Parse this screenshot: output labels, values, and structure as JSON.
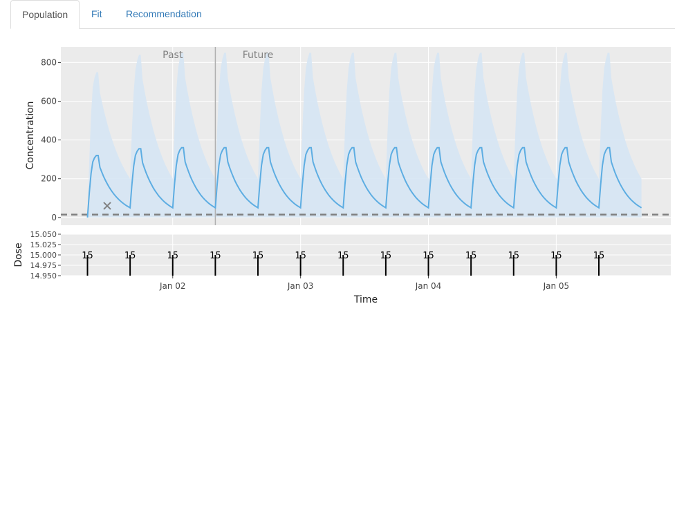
{
  "tabs": [
    {
      "label": "Population",
      "active": true
    },
    {
      "label": "Fit",
      "active": false
    },
    {
      "label": "Recommendation",
      "active": false
    }
  ],
  "colors": {
    "background": "#ebebeb",
    "prediction_line": "#5dade2",
    "interval_band": "#d6e6f4",
    "threshold": "#7f7f7f",
    "observation": "#7f7f7f",
    "dose_bar": "#000000"
  },
  "chart_data": [
    {
      "type": "area",
      "ylabel": "Concentration",
      "xlabel": "",
      "ylim": [
        -40,
        880
      ],
      "y_ticks": [
        0,
        200,
        400,
        600,
        800
      ],
      "x_range_hours": [
        0,
        114.5
      ],
      "x_ticks": [
        {
          "hour": 21,
          "label": "Jan 02"
        },
        {
          "hour": 45,
          "label": "Jan 03"
        },
        {
          "hour": 69,
          "label": "Jan 04"
        },
        {
          "hour": 93,
          "label": "Jan 05"
        }
      ],
      "now_hour": 29,
      "regions": [
        {
          "label": "Past",
          "hour": 21
        },
        {
          "label": "Future",
          "hour": 37
        }
      ],
      "threshold": 15,
      "dose_interval_hours": 8,
      "dose_start_hour": 5,
      "num_doses": 13,
      "prediction_end_hour": 109,
      "median_peak": [
        320,
        355,
        360,
        360,
        360,
        360,
        360,
        360,
        360,
        360,
        360,
        360,
        360
      ],
      "median_trough": [
        50,
        50,
        50,
        50,
        50,
        50,
        50,
        50,
        50,
        50,
        50,
        50,
        50
      ],
      "upper_peak": [
        750,
        840,
        850,
        850,
        850,
        850,
        850,
        850,
        850,
        850,
        850,
        850,
        850
      ],
      "upper_trough": [
        200,
        200,
        200,
        200,
        200,
        200,
        200,
        200,
        200,
        200,
        200,
        200,
        200
      ],
      "observations": [
        {
          "hour": 8.7,
          "value": 60
        }
      ]
    },
    {
      "type": "bar",
      "ylabel": "Dose",
      "xlabel": "Time",
      "ylim": [
        14.95,
        15.05
      ],
      "y_ticks": [
        14.95,
        14.975,
        15.0,
        15.025,
        15.05
      ],
      "y_tick_labels": [
        "14.950",
        "14.975",
        "15.000",
        "15.025",
        "15.050"
      ],
      "dose_hours": [
        5,
        13,
        21,
        29,
        37,
        45,
        53,
        61,
        69,
        77,
        85,
        93,
        101
      ],
      "dose_values": [
        15,
        15,
        15,
        15,
        15,
        15,
        15,
        15,
        15,
        15,
        15,
        15,
        15
      ],
      "dose_labels": [
        "15",
        "15",
        "15",
        "15",
        "15",
        "15",
        "15",
        "15",
        "15",
        "15",
        "15",
        "15",
        "15"
      ]
    }
  ]
}
